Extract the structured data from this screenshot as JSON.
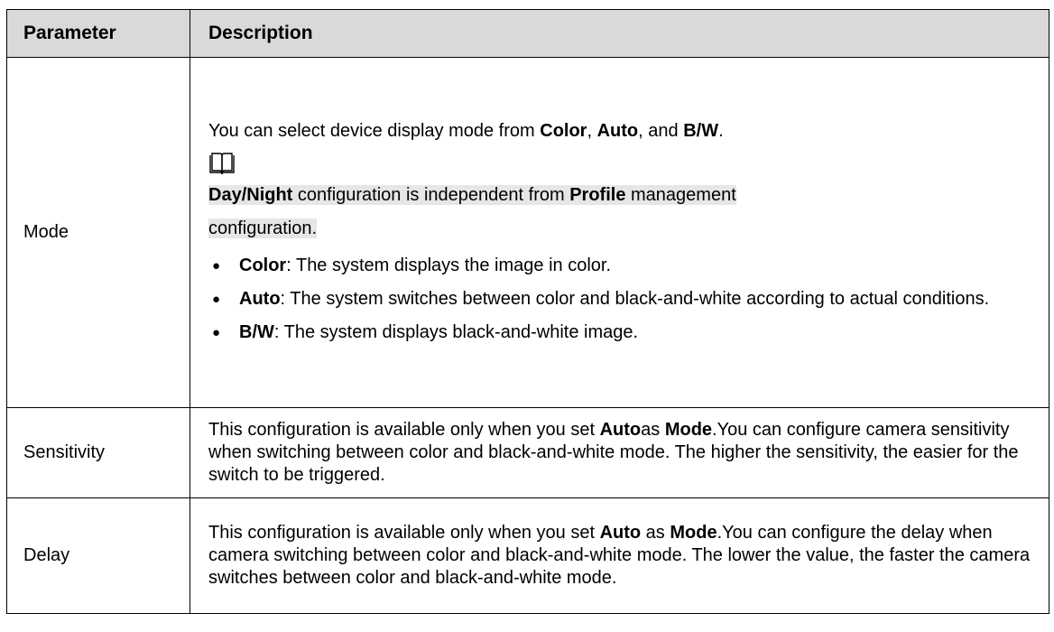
{
  "header": {
    "parameter": "Parameter",
    "description": "Description"
  },
  "rows": {
    "mode": {
      "name": "Mode",
      "intro": {
        "t1": "You can select device display mode from ",
        "b1": "Color",
        "t2": ", ",
        "b2": "Auto",
        "t3": ", and ",
        "b3": "B/W",
        "t4": "."
      },
      "note": {
        "b1": "Day/Night",
        "t1": " configuration is independent from ",
        "b2": "Profile",
        "t2": " management",
        "t3": "configuration."
      },
      "bullets": [
        {
          "b": "Color",
          "t": ": The system displays the image in color."
        },
        {
          "b": "Auto",
          "t": ": The system switches between color and black-and-white according to actual conditions."
        },
        {
          "b": "B/W",
          "t": ": The system displays black-and-white image."
        }
      ]
    },
    "sensitivity": {
      "name": "Sensitivity",
      "t1": "This configuration is available only when you set ",
      "b1": "Auto",
      "t2": "as ",
      "b2": "Mode",
      "t3": ".You can configure camera sensitivity when switching between color and black-and-white mode. The higher the sensitivity, the easier for the switch to be triggered."
    },
    "delay": {
      "name": "Delay",
      "t1": "This configuration is available only when you set ",
      "b1": "Auto",
      "t2": " as ",
      "b2": "Mode",
      "t3": ".You can configure the delay when camera switching between color and black-and-white mode. The lower the value, the faster the camera switches between color and black-and-white mode."
    }
  },
  "icons": {
    "note": "open-book-icon"
  }
}
